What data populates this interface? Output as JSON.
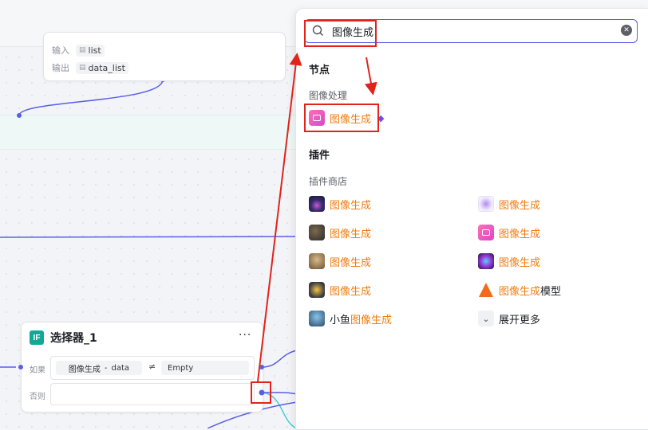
{
  "top_node": {
    "input_label": "输入",
    "input_value": "list",
    "output_label": "输出",
    "output_value": "data_list"
  },
  "selector_node": {
    "badge": "IF",
    "title": "选择器_1",
    "more": "···",
    "if_label": "如果",
    "cond_left_a": "图像生成",
    "cond_left_sep": "-",
    "cond_left_b": "data",
    "cond_operator": "≠",
    "cond_right": "Empty",
    "else_label": "否则"
  },
  "search": {
    "value": "图像生成",
    "placeholder": ""
  },
  "panel": {
    "section_nodes": "节点",
    "group_image_processing": "图像处理",
    "node_item": {
      "hl": "图像生成",
      "rest": ""
    },
    "section_plugins": "插件",
    "group_plugin_store": "插件商店",
    "plugins": [
      {
        "hl": "图像生成",
        "pre": "",
        "rest": "",
        "icon": "neon-portrait-thumb"
      },
      {
        "hl": "图像生成",
        "pre": "",
        "rest": "",
        "icon": "sparkle-thumb"
      },
      {
        "hl": "图像生成",
        "pre": "",
        "rest": "",
        "icon": "dark-art-thumb"
      },
      {
        "hl": "图像生成",
        "pre": "",
        "rest": "",
        "icon": "image-gen-thumb"
      },
      {
        "hl": "图像生成",
        "pre": "",
        "rest": "",
        "icon": "sepia-portrait-thumb"
      },
      {
        "hl": "图像生成",
        "pre": "",
        "rest": "",
        "icon": "neon-city-thumb"
      },
      {
        "hl": "图像生成",
        "pre": "",
        "rest": "",
        "icon": "yellow-badge-thumb"
      },
      {
        "hl": "图像生成",
        "pre": "",
        "rest": "模型",
        "icon": "orange-triangle-thumb"
      },
      {
        "hl": "图像生成",
        "pre": "小鱼",
        "rest": "",
        "icon": "fish-thumb"
      }
    ],
    "expand_more": "展开更多"
  },
  "colors": {
    "accent": "#5a5ee6",
    "highlight_text": "#f07d12",
    "annotation_red": "#e0241b",
    "edge": "#5a5ee6",
    "edge_teal": "#4fc9d6"
  }
}
